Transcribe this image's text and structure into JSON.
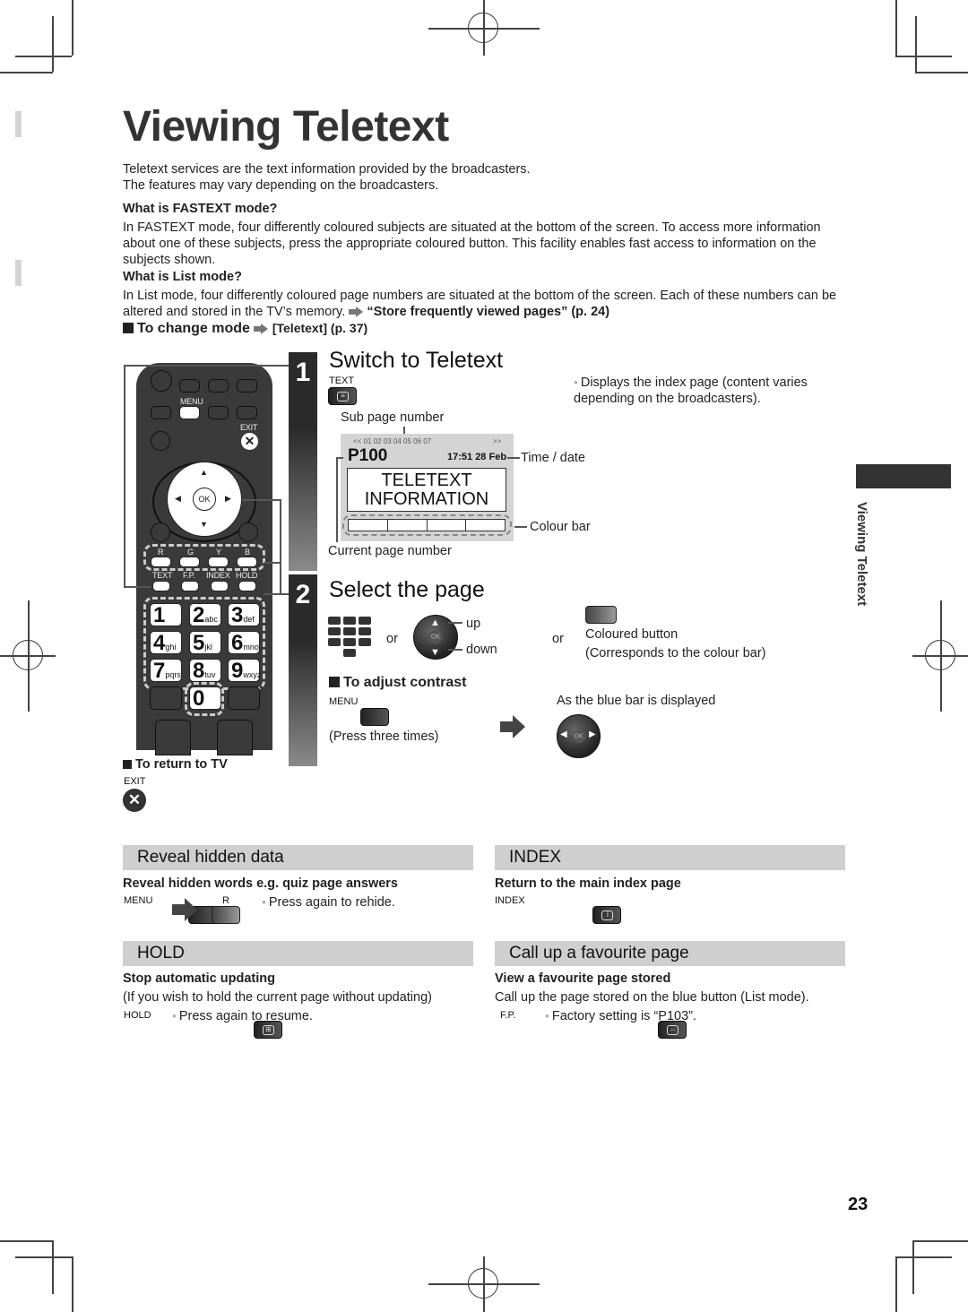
{
  "page": {
    "title": "Viewing Teletext",
    "page_number": "23",
    "side_tab_label": "Viewing Teletext"
  },
  "intro": {
    "line1": "Teletext services are the text information provided by the broadcasters.",
    "line2": "The features may vary depending on the broadcasters."
  },
  "fastext": {
    "heading": "What is FASTEXT mode?",
    "body": "In FASTEXT mode, four differently coloured subjects are situated at the bottom of the screen. To access more information about one of these subjects, press the appropriate coloured button. This facility enables fast access to information on the subjects shown."
  },
  "list_mode": {
    "heading": "What is List mode?",
    "body": "In List mode, four differently coloured page numbers are situated at the bottom of the screen. Each of these numbers can be altered and stored in the TV’s memory.",
    "link": "“Store frequently viewed pages” (p. 24)"
  },
  "change_mode": {
    "label": "To change mode",
    "link": "[Teletext] (p. 37)"
  },
  "remote": {
    "menu": "MENU",
    "exit": "EXIT",
    "ok": "OK",
    "colour_keys": [
      "R",
      "G",
      "Y",
      "B"
    ],
    "func_keys": [
      "TEXT",
      "F.P.",
      "INDEX",
      "HOLD"
    ],
    "num_keys": [
      {
        "d": "1",
        "l": ""
      },
      {
        "d": "2",
        "l": "abc"
      },
      {
        "d": "3",
        "l": "def"
      },
      {
        "d": "4",
        "l": "ghi"
      },
      {
        "d": "5",
        "l": "jkl"
      },
      {
        "d": "6",
        "l": "mno"
      },
      {
        "d": "7",
        "l": "pqrs"
      },
      {
        "d": "8",
        "l": "tuv"
      },
      {
        "d": "9",
        "l": "wxyz"
      }
    ],
    "zero": "0"
  },
  "return_tv": {
    "label": "To return to TV",
    "button": "EXIT"
  },
  "step1": {
    "number": "1",
    "title": "Switch to Teletext",
    "button_label": "TEXT",
    "note": "Displays the index page (content varies depending on the broadcasters).",
    "sub_page_label": "Sub page number",
    "screen": {
      "sub_pages": "<< 01 02 03 04 05 06 07",
      "next": ">>",
      "page": "P100",
      "time_date": "17:51 28 Feb",
      "info_line1": "TELETEXT",
      "info_line2": "INFORMATION"
    },
    "time_date_label": "Time / date",
    "colour_bar_label": "Colour bar",
    "current_page_label": "Current page number"
  },
  "step2": {
    "number": "2",
    "title": "Select the page",
    "or1": "or",
    "up": "up",
    "down": "down",
    "or2": "or",
    "coloured_button": "Coloured button",
    "coloured_note": "(Corresponds to the colour bar)",
    "contrast_heading": "To adjust contrast",
    "menu_label": "MENU",
    "press_three": "(Press three times)",
    "blue_bar": "As the blue bar is displayed",
    "ok": "OK"
  },
  "reveal": {
    "heading": "Reveal hidden data",
    "sub": "Reveal hidden words e.g. quiz page answers",
    "menu": "MENU",
    "r": "R",
    "note": "Press again to rehide."
  },
  "index": {
    "heading": "INDEX",
    "sub": "Return to the main index page",
    "button": "INDEX"
  },
  "hold": {
    "heading": "HOLD",
    "sub": "Stop automatic updating",
    "body": "(If you wish to hold the current page without updating)",
    "button": "HOLD",
    "note": "Press again to resume."
  },
  "favourite": {
    "heading": "Call up a favourite page",
    "sub": "View a favourite page stored",
    "body": "Call up the page stored on the blue button (List mode).",
    "button": "F.P.",
    "note": "Factory setting is “P103”."
  }
}
